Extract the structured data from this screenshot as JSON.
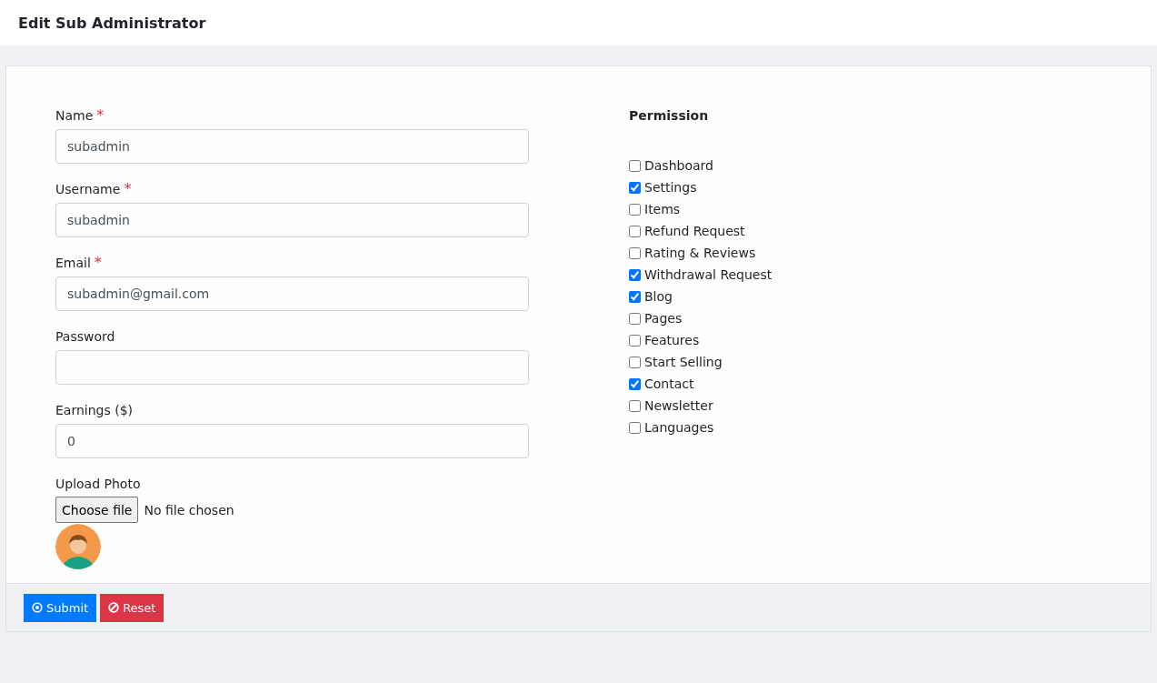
{
  "page": {
    "title": "Edit Sub Administrator"
  },
  "fields": [
    {
      "label": "Name",
      "required_mark": "*",
      "value": "subadmin"
    },
    {
      "label": "Username",
      "required_mark": "*",
      "value": "subadmin"
    },
    {
      "label": "Email",
      "required_mark": "*",
      "value": "subadmin@gmail.com"
    },
    {
      "label": "Password"
    },
    {
      "label": "Earnings ($)",
      "value": "0"
    }
  ],
  "upload": {
    "label": "Upload Photo",
    "button": "Choose file",
    "status": "No file chosen"
  },
  "permission": {
    "title": "Permission",
    "items": [
      {
        "label": "Dashboard",
        "checked": false
      },
      {
        "label": "Settings",
        "checked": true
      },
      {
        "label": "Items",
        "checked": false
      },
      {
        "label": "Refund Request",
        "checked": false
      },
      {
        "label": "Rating & Reviews",
        "checked": false
      },
      {
        "label": "Withdrawal Request",
        "checked": true
      },
      {
        "label": "Blog",
        "checked": true
      },
      {
        "label": "Pages",
        "checked": false
      },
      {
        "label": "Features",
        "checked": false
      },
      {
        "label": "Start Selling",
        "checked": false
      },
      {
        "label": "Contact",
        "checked": true
      },
      {
        "label": "Newsletter",
        "checked": false
      },
      {
        "label": "Languages",
        "checked": false
      }
    ]
  },
  "actions": [
    {
      "kind": "submit",
      "label": "Submit"
    },
    {
      "kind": "reset",
      "label": "Reset"
    }
  ]
}
